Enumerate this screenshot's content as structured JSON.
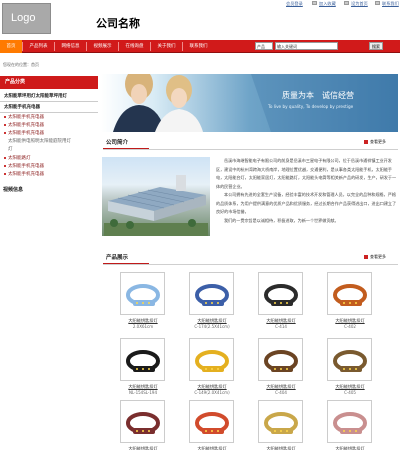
{
  "header": {
    "logo_text": "Logo",
    "company_name": "公司名称",
    "top_links": [
      "会员登录",
      "加入收藏",
      "设为首页",
      "联系我们"
    ]
  },
  "nav": {
    "items": [
      "首页",
      "产品列表",
      "网络信息",
      "视频展示",
      "在线询盘",
      "关于我们",
      "联系我们"
    ],
    "active_index": 0,
    "search_select": "产品",
    "search_placeholder": "输入关键词",
    "search_button": "搜索"
  },
  "breadcrumb": "您现在的位置：首页",
  "sidebar": {
    "title": "产品分类",
    "categories": [
      {
        "label": "太阳能草坪用灯太阳能草坪用灯",
        "type": "main"
      },
      {
        "label": "太阳能手机充电器",
        "type": "main"
      },
      {
        "label": "太阳能手机充电器",
        "type": "sub"
      },
      {
        "label": "太阳能手机充电器",
        "type": "sub"
      },
      {
        "label": "太阳能手机充电器",
        "type": "sub"
      },
      {
        "label": "太阳能供电照明太阳能庭院用灯",
        "type": "grey"
      },
      {
        "label": "灯",
        "type": "grey"
      },
      {
        "label": "太阳能路灯",
        "type": "sub"
      },
      {
        "label": "太阳能手机充电器",
        "type": "sub"
      },
      {
        "label": "太阳能手机充电器",
        "type": "sub"
      }
    ],
    "video_label": "视频信息"
  },
  "banner": {
    "slogan": "质量为本　诚信经营",
    "slogan_en": "To live by quality, To develop by prestige"
  },
  "intro": {
    "title": "公司简介",
    "more": "查看更多",
    "paragraphs": [
      "岳溪市海继智能电子有限公司的前身是岳溪市三星电子有限公司，位于岳溪市通祥镇工业开发区，建设中的杭州湾跨海大桥南岸，地理位置优越，交通便利，是从事各类太阳能手机，太阳能手电，太阳能台灯，太阳能家居灯，太阳能路灯，太阳能头电筒等相关新产品的研发，生产，研发于一体的民营企业。",
      "本公司拥有先进的全套生产设备，经验丰富的技术开发和管理人员，以完全的品种和规格，严格的品质体系，为用户提供满意的优质产品和优质服务，经过长期合作产品获得进出口，进出口建立了良好的市场信誉。",
      "我们的一贯宗旨是以诚相待，积极进取，为新一个世界做贡献。"
    ]
  },
  "products": {
    "title": "产品展示",
    "more": "查看更多",
    "items": [
      {
        "name": "大阳能钥匙扣灯",
        "code": "2.0X61cm",
        "color": "#8ab7e3"
      },
      {
        "name": "大阳能钥匙扣灯",
        "code": "C-174(2.5X41cm)",
        "color": "#3c5fa8"
      },
      {
        "name": "大阳能钥匙扣灯",
        "code": "C-414",
        "color": "#2b2b2b"
      },
      {
        "name": "大阳能钥匙扣灯",
        "code": "C-402",
        "color": "#c25c1e"
      },
      {
        "name": "大阳能钥匙扣灯",
        "code": "NL-154SL-194",
        "color": "#1a1a1a"
      },
      {
        "name": "大阳能钥匙扣灯",
        "code": "C-149(2.0X41cm)",
        "color": "#e4b020"
      },
      {
        "name": "大阳能钥匙扣灯",
        "code": "C-404",
        "color": "#6b4423"
      },
      {
        "name": "大阳能钥匙扣灯",
        "code": "C-405",
        "color": "#7a5a2f"
      },
      {
        "name": "大阳能钥匙扣灯",
        "code": "",
        "color": "#7a2e2e"
      },
      {
        "name": "大阳能钥匙扣灯",
        "code": "",
        "color": "#d14b2c"
      },
      {
        "name": "大阳能钥匙扣灯",
        "code": "",
        "color": "#c9a74a"
      },
      {
        "name": "大阳能钥匙扣灯",
        "code": "",
        "color": "#c98f8f"
      }
    ]
  },
  "colors": {
    "nav_red": "#d11a1a",
    "nav_active": "#ff7a00",
    "sidebar_head": "#ce1a1a",
    "banner_blue": "#4a86b8"
  }
}
